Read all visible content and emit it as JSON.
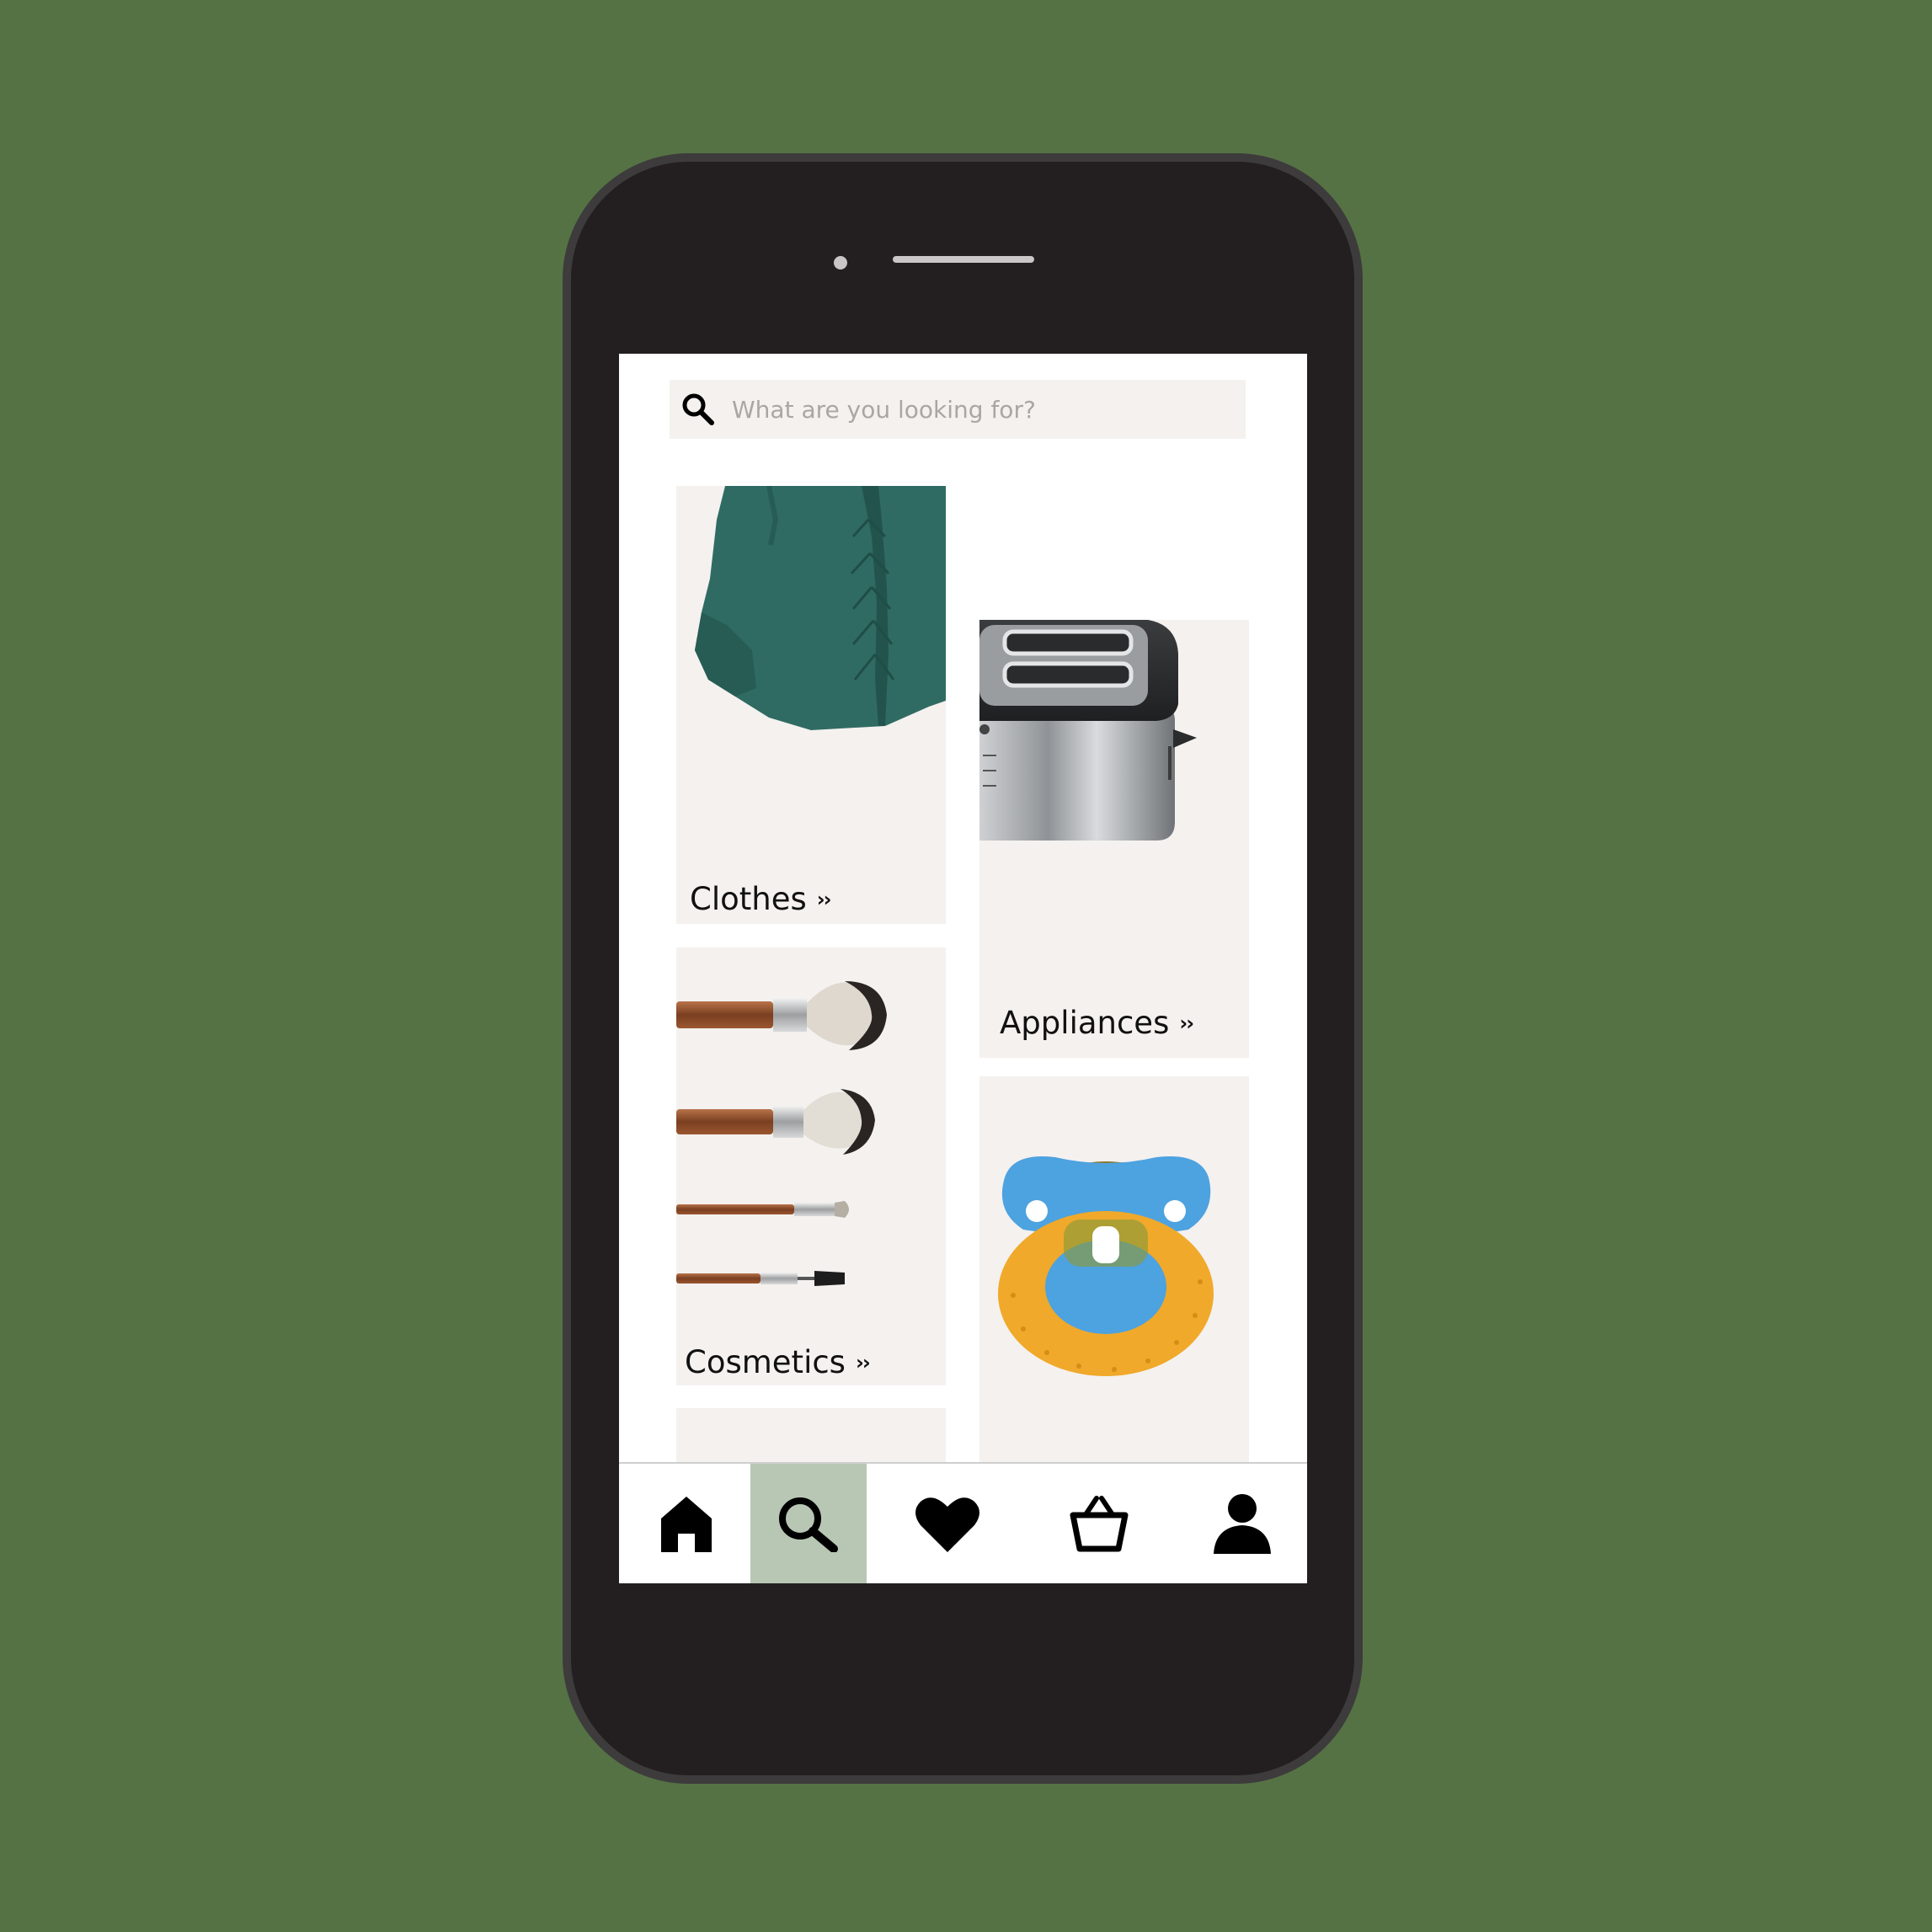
{
  "search": {
    "placeholder": "What are you looking for?"
  },
  "categories": [
    {
      "label": "Clothes",
      "chevron": "››",
      "image": "green-knit-sweater"
    },
    {
      "label": "Appliances",
      "chevron": "››",
      "image": "chrome-toaster"
    },
    {
      "label": "Cosmetics",
      "chevron": "››",
      "image": "makeup-brushes"
    },
    {
      "label": "",
      "chevron": "",
      "image": "baby-pacifier"
    }
  ],
  "tabbar": {
    "items": [
      {
        "icon": "home-icon",
        "active": false
      },
      {
        "icon": "search-icon",
        "active": true
      },
      {
        "icon": "heart-icon",
        "active": false
      },
      {
        "icon": "basket-icon",
        "active": false
      },
      {
        "icon": "profile-icon",
        "active": false
      }
    ],
    "active_color": "#b8c7b4"
  },
  "colors": {
    "background": "#557244",
    "phone_body": "#231f20",
    "tile_background": "#f4f1ef",
    "placeholder_text": "#a9a6a4"
  }
}
